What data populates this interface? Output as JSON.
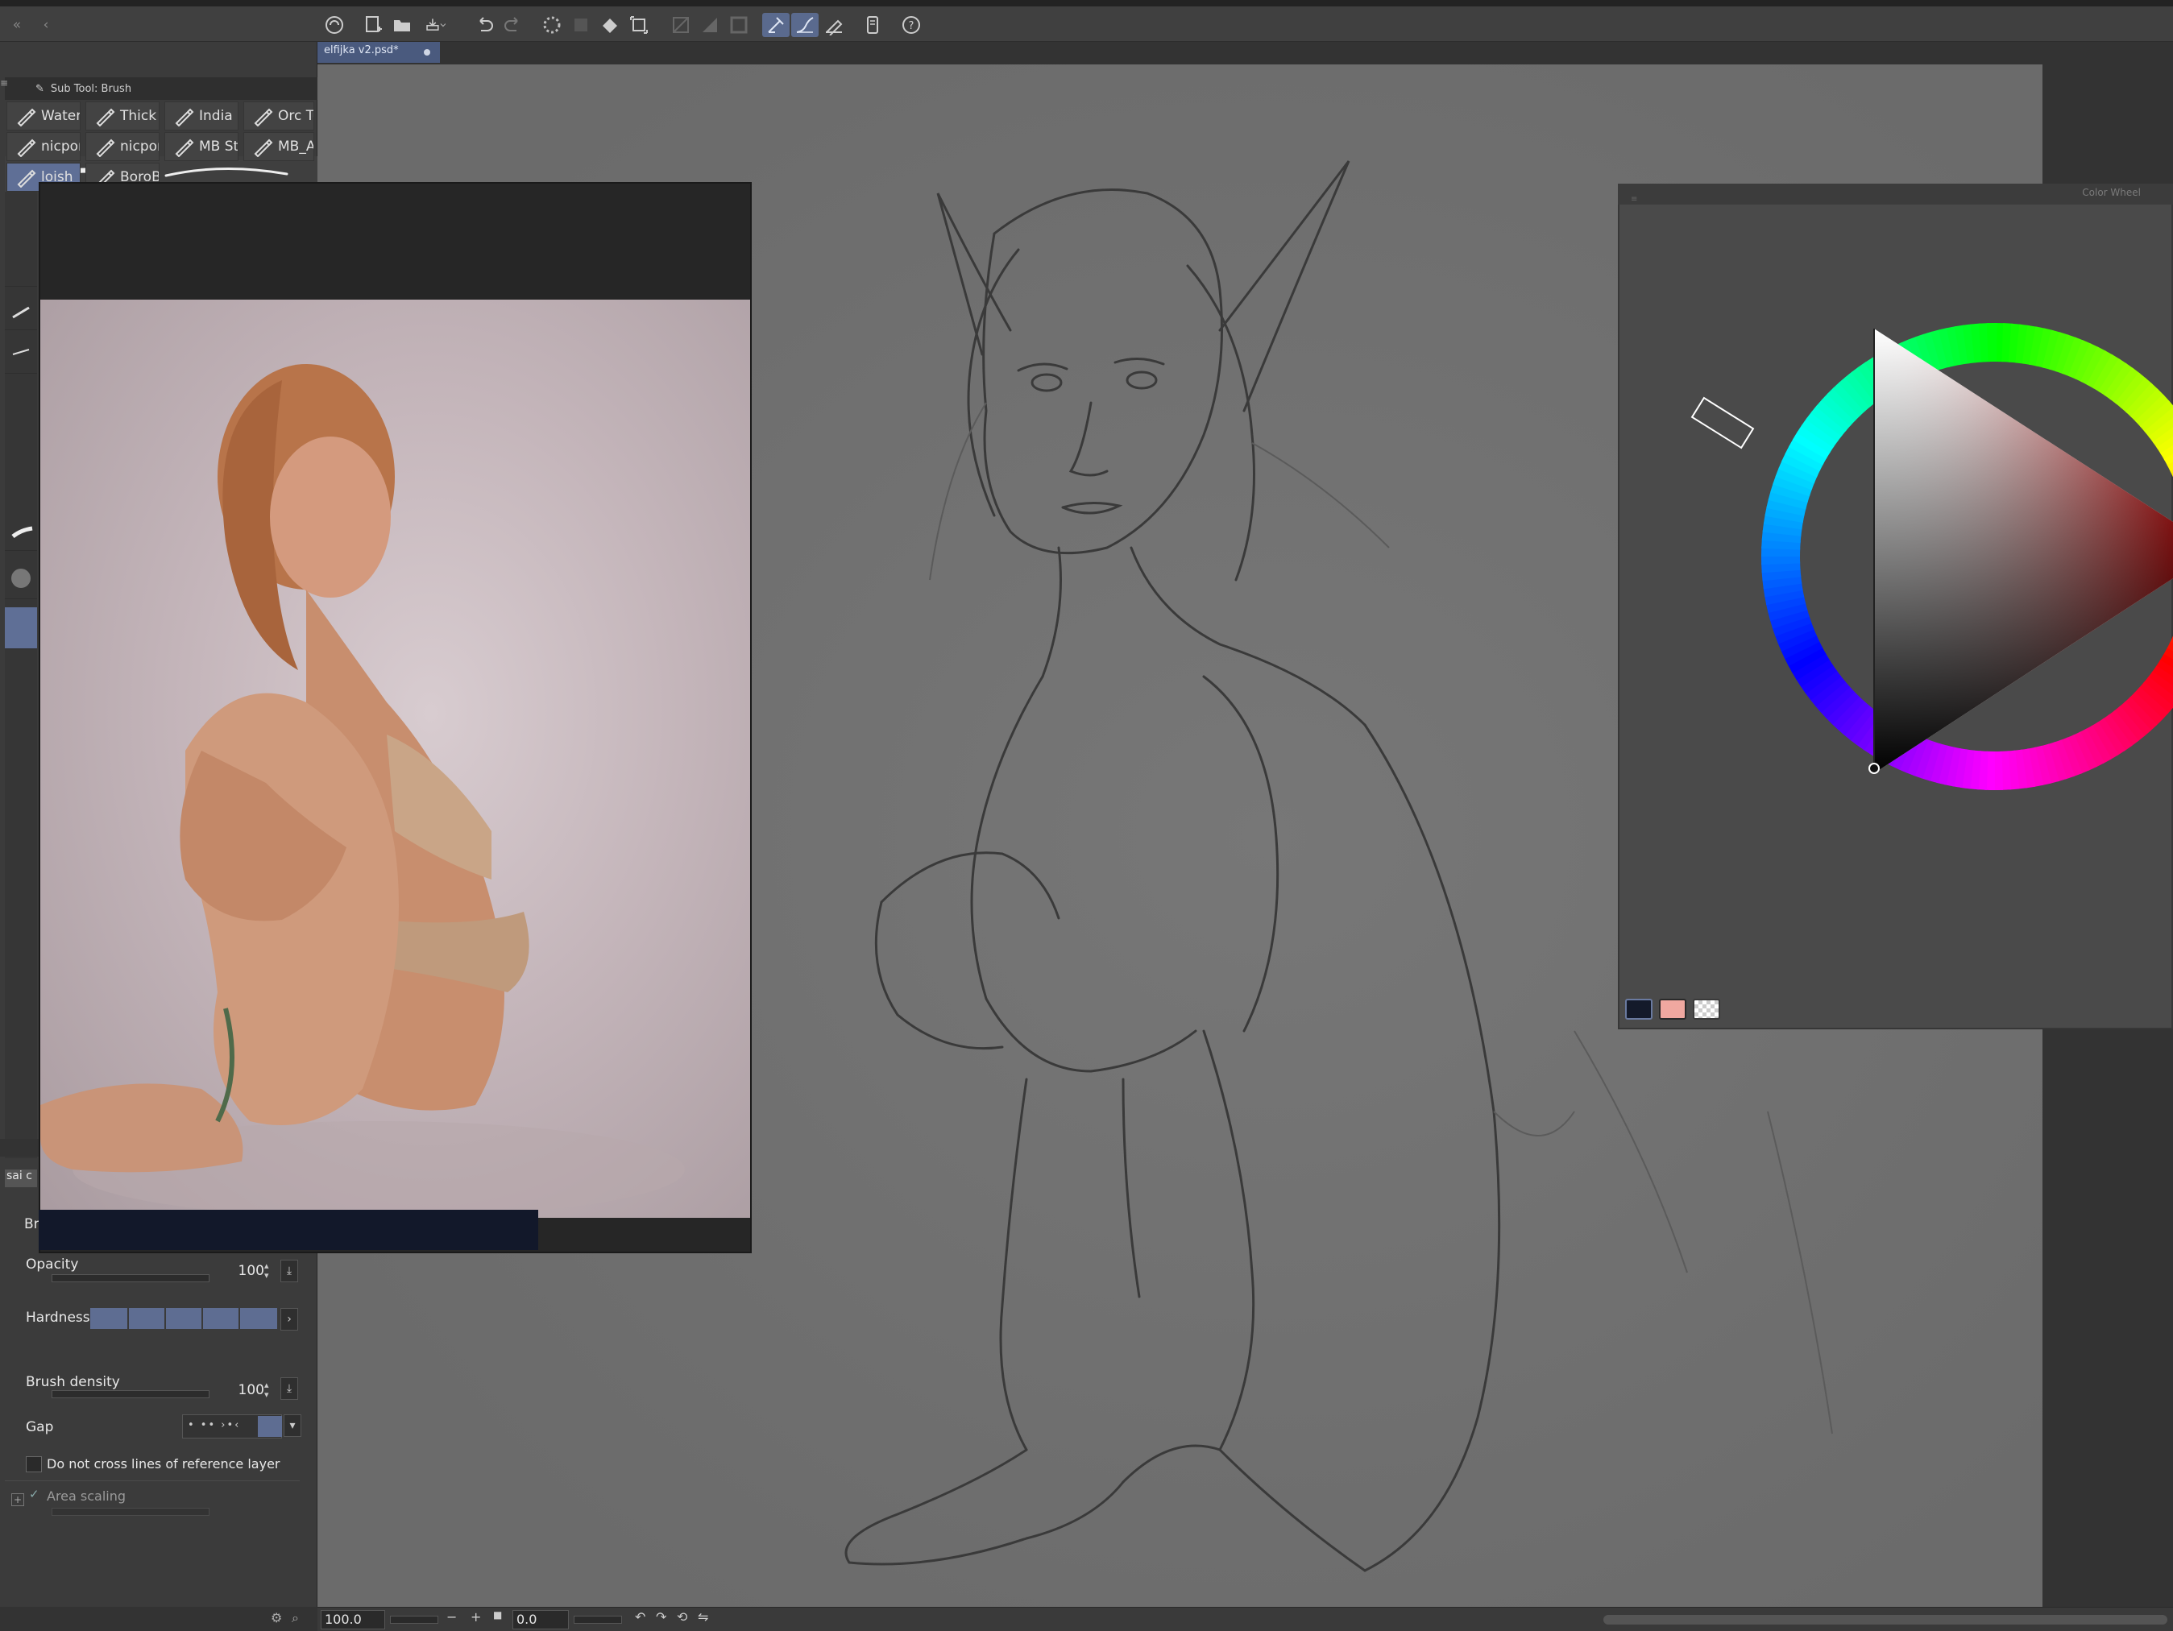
{
  "document_tab": {
    "title": "elfijka v2.psd*"
  },
  "subtool": {
    "header": "Sub Tool: Brush"
  },
  "brushes": [
    {
      "label": "Water"
    },
    {
      "label": "Thick"
    },
    {
      "label": "India i"
    },
    {
      "label": "Orc Tu"
    },
    {
      "label": "nicpon"
    },
    {
      "label": "nicpon"
    },
    {
      "label": "MB St"
    },
    {
      "label": "MB_A"
    },
    {
      "label": "loish",
      "selected": true
    },
    {
      "label": "BoroB"
    }
  ],
  "properties": {
    "preset_name": "sai c",
    "section_label": "Br",
    "opacity": {
      "label": "Opacity",
      "value": "100"
    },
    "hardness": {
      "label": "Hardness"
    },
    "brush_density": {
      "label": "Brush density",
      "value": "100"
    },
    "gap": {
      "label": "Gap"
    },
    "reference_checkbox": {
      "label": "Do not cross lines of reference layer",
      "checked": false
    },
    "area_scaling": {
      "label": "Area scaling",
      "checked": true
    }
  },
  "color_wheel": {
    "title": "Color Wheel",
    "main_color": "#141a2a",
    "sub_color": "#f0a8a0",
    "hue_deg": 0
  },
  "statusbar": {
    "zoom": "100.0",
    "rotation": "0.0"
  },
  "colors": {
    "accent": "#5a6a8e",
    "canvas": "#6b6b6b",
    "panel": "#3b3b3b"
  },
  "toolbar_icons": [
    "clip-studio-icon",
    "new-file-icon",
    "open-folder-icon",
    "save-icon",
    "undo-icon",
    "redo-icon",
    "loading-icon",
    "clear-icon",
    "fill-icon",
    "transform-icon",
    "snap-off-icon",
    "snap-ruler-icon",
    "snap-grid-icon",
    "stabilizer-icon",
    "pen-pressure-icon",
    "eraser-snap-icon",
    "smartphone-icon",
    "help-icon"
  ]
}
